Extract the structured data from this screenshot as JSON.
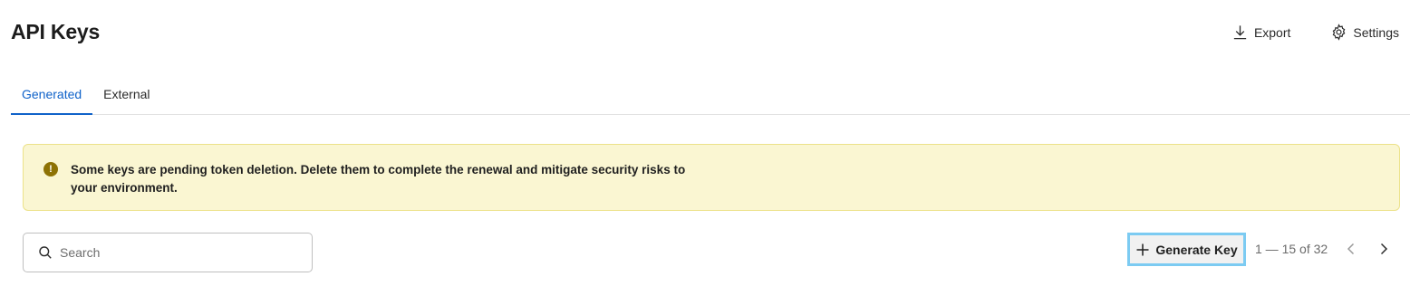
{
  "header": {
    "title": "API Keys",
    "export_label": "Export",
    "settings_label": "Settings"
  },
  "tabs": [
    {
      "label": "Generated",
      "active": true
    },
    {
      "label": "External",
      "active": false
    }
  ],
  "banner": {
    "icon": "exclamation-icon",
    "text": "Some keys are pending token deletion. Delete them to complete the renewal and mitigate security risks to your environment."
  },
  "search": {
    "placeholder": "Search",
    "value": ""
  },
  "toolbar": {
    "generate_label": "Generate Key",
    "pagination": "1 — 15 of 32"
  },
  "colors": {
    "accent": "#0f62c9",
    "banner_bg": "#faf6d2",
    "banner_icon": "#8d7204",
    "focus_ring": "#7ccbf2"
  }
}
